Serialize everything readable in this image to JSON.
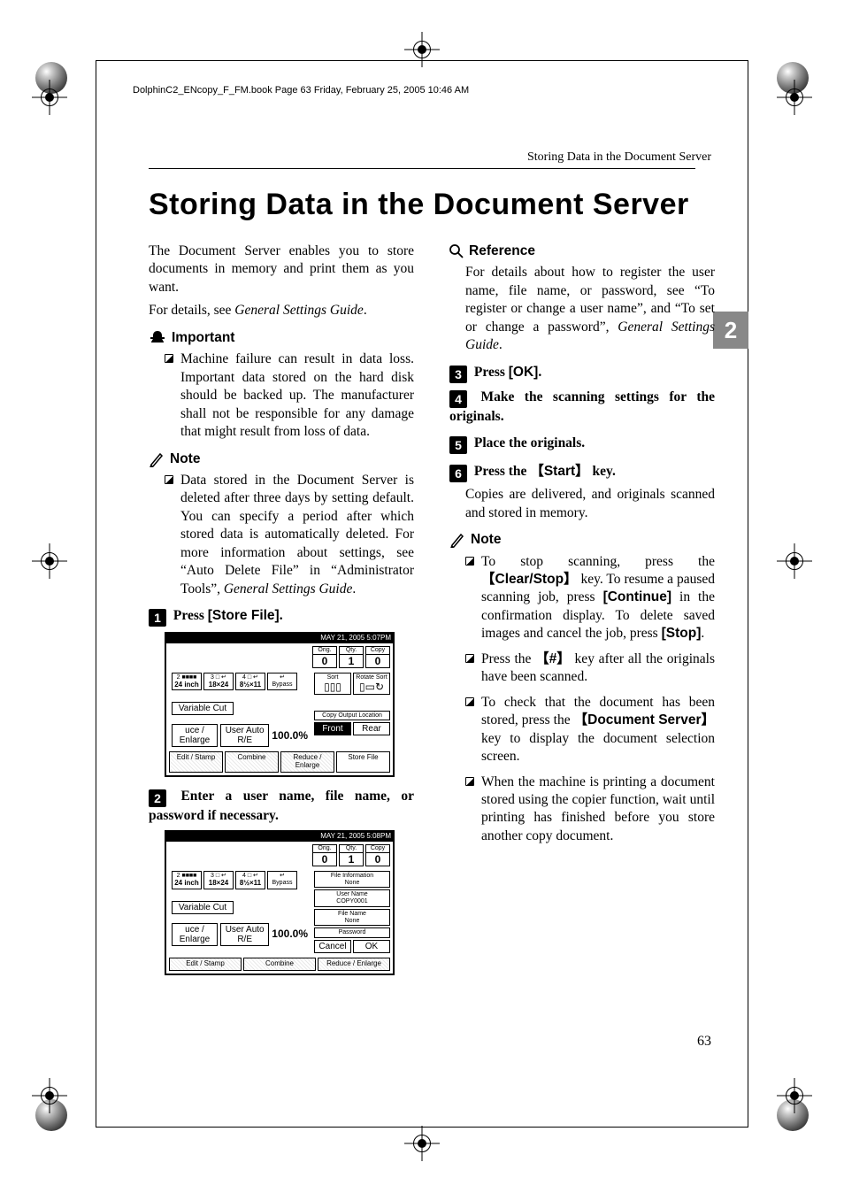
{
  "book_line": "DolphinC2_ENcopy_F_FM.book  Page 63  Friday, February 25, 2005  10:46 AM",
  "running_head": "Storing Data in the Document Server",
  "title": "Storing Data in the Document Server",
  "tab_number": "2",
  "page_number": "63",
  "intro_p1": "The Document Server enables you to store documents in memory and print them as you want.",
  "intro_p2a": "For details, see ",
  "intro_p2b": "General Settings Guide",
  "intro_p2c": ".",
  "important_label": "Important",
  "important_body": "Machine failure can result in data loss. Important data stored on the hard disk should be backed up. The manufacturer shall not be responsible for any damage that might result from loss of data.",
  "note_label": "Note",
  "note_left_a": "Data stored in the Document Server is deleted after three days by setting default. You can specify a period after which stored data is automatically deleted. For more information about settings, see “Auto Delete File” in “Administrator Tools”, ",
  "note_left_b": "General Settings Guide",
  "note_left_c": ".",
  "step1_a": "Press ",
  "step1_b": "[Store File]",
  "step1_c": ".",
  "step2": "Enter a user name, file name, or password if necessary.",
  "reference_label": "Reference",
  "reference_a": "For details about how to register the user name, file name, or password, see “To register or change a user name”, and “To set or change a password”, ",
  "reference_b": "General Settings Guide",
  "reference_c": ".",
  "step3_a": "Press ",
  "step3_b": "[OK]",
  "step3_c": ".",
  "step4": "Make the scanning settings for the originals.",
  "step5": "Place the originals.",
  "step6_a": "Press the ",
  "step6_key": "Start",
  "step6_b": " key.",
  "step6_body": "Copies are delivered, and originals scanned and stored in memory.",
  "rnote1_a": "To stop scanning, press the ",
  "rnote1_key1": "Clear/Stop",
  "rnote1_b": " key. To resume a paused scanning job, press ",
  "rnote1_btn1": "[Continue]",
  "rnote1_c": " in the confirmation display. To delete saved images and cancel the job, press ",
  "rnote1_btn2": "[Stop]",
  "rnote1_d": ".",
  "rnote2_a": "Press the ",
  "rnote2_key": "#",
  "rnote2_b": " key after all the originals have been scanned.",
  "rnote3_a": "To check that the document has been stored, press the ",
  "rnote3_key": "Document Server",
  "rnote3_b": " key to display the document selection screen.",
  "rnote4": "When the machine is printing a document stored using the copier function, wait until printing has finished before you store another copy document.",
  "shot": {
    "status_time1": "MAY   21, 2005   5:07PM",
    "status_time2": "MAY   21, 2005   5:08PM",
    "orig_lbl": "Orig.",
    "qty_lbl": "Qty.",
    "copy_lbl": "Copy",
    "zero": "0",
    "one": "1",
    "tray1_top": "2 ■■■■",
    "tray1_sz": "24 inch",
    "tray2_top": "3 □ ↵",
    "tray2_sz": "18×24",
    "tray3_top": "4 □ ↵",
    "tray3_sz": "8½×11",
    "bypass": "Bypass",
    "bypass_icon": "↵",
    "varcut": "Variable Cut",
    "uce": "uce / Enlarge",
    "uar": "User Auto R/E",
    "ratio": "100.0%",
    "sort_lbl": "Sort",
    "rotate_lbl": "Rotate Sort",
    "col_lbl": "Copy Output Location",
    "front": "Front",
    "rear": "Rear",
    "b_edit": "Edit / Stamp",
    "b_comb": "Combine",
    "b_re": "Reduce / Enlarge",
    "b_store": "Store File",
    "fi": "File Information",
    "none": "None",
    "un": "User Name",
    "un_v": "COPY0001",
    "fn": "File Name",
    "fn_v": "None",
    "pw": "Password",
    "cancel": "Cancel",
    "ok": "OK"
  }
}
